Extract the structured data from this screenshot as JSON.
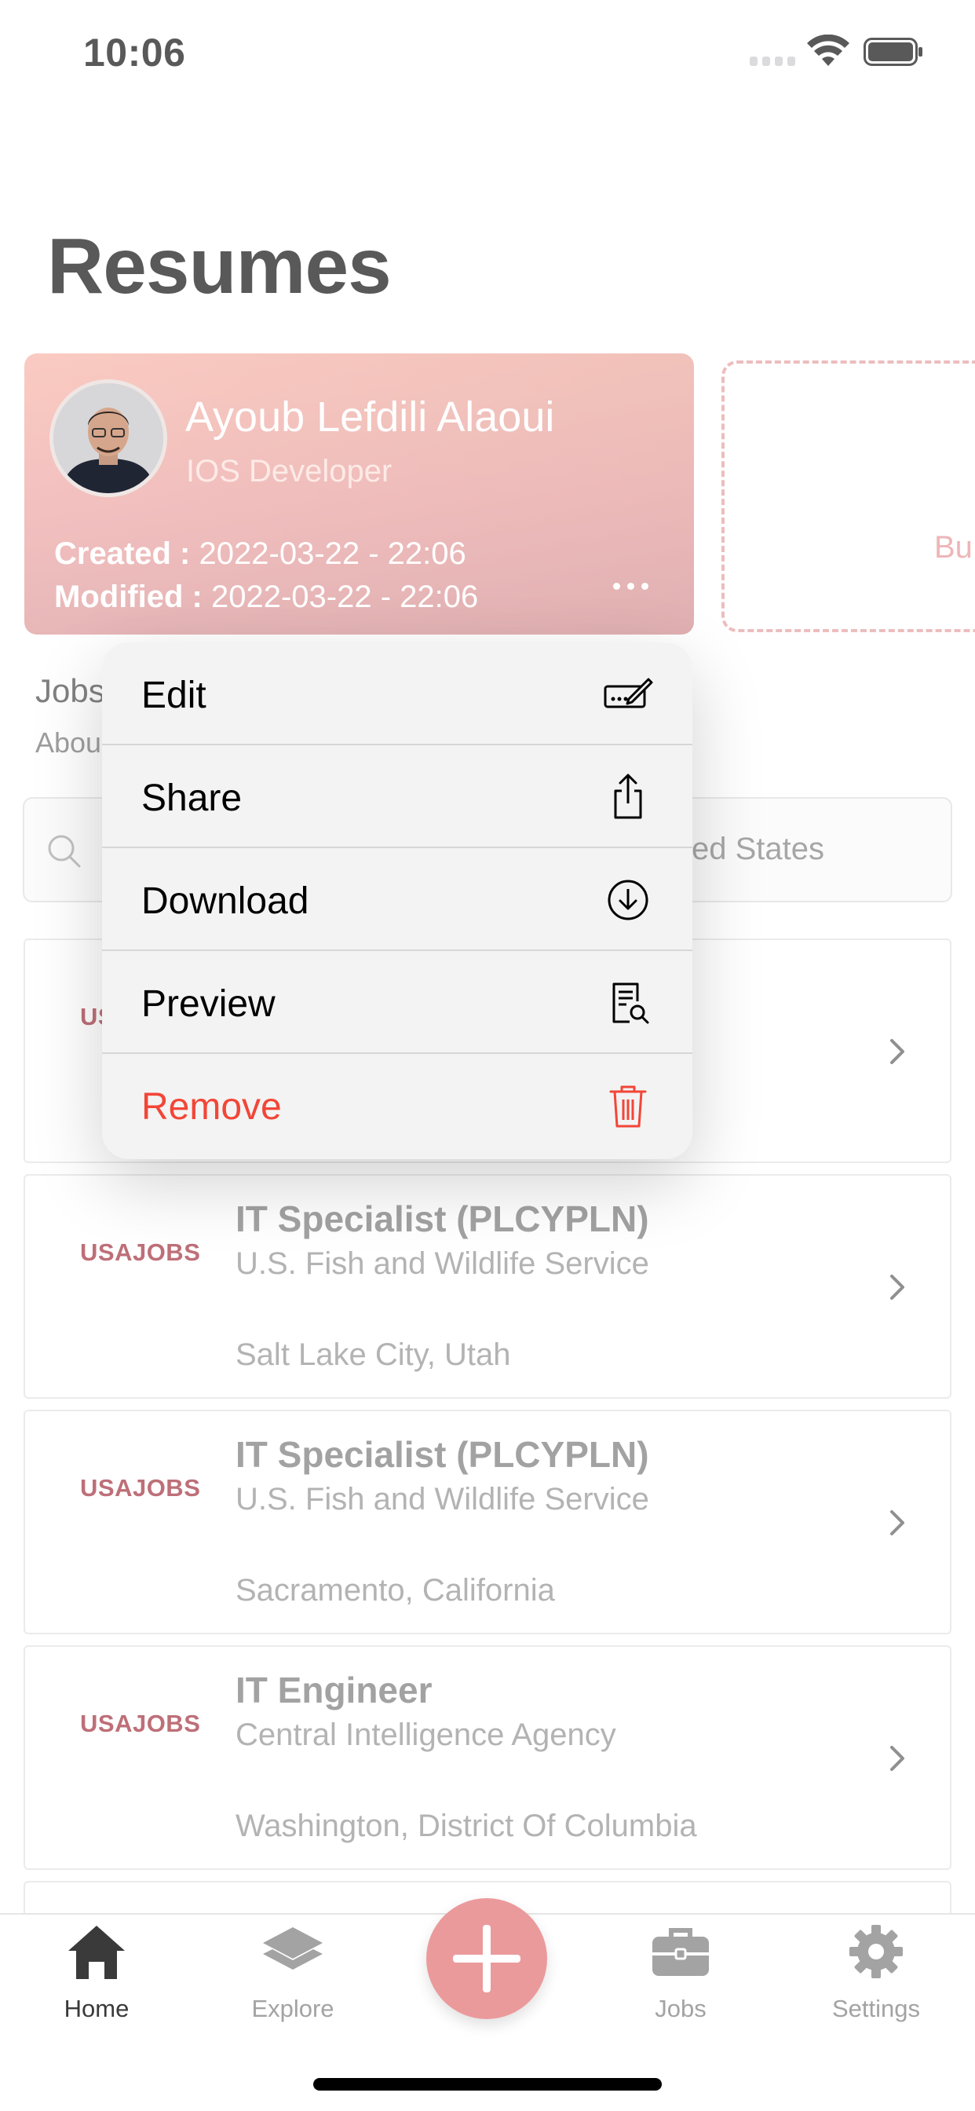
{
  "status_bar": {
    "time": "10:06"
  },
  "page": {
    "title": "Resumes"
  },
  "resume_card": {
    "name": "Ayoub Lefdili Alaoui",
    "role": "IOS Developer",
    "created_label": "Created :",
    "created_value": "2022-03-22 - 22:06",
    "modified_label": "Modified :",
    "modified_value": "2022-03-22 - 22:06"
  },
  "add_resume": {
    "label": "Bu"
  },
  "jobs_section": {
    "heading": "Jobs",
    "sub": "Abou"
  },
  "search": {
    "location": "ed States"
  },
  "context_menu": {
    "items": [
      {
        "label": "Edit",
        "icon": "signature-icon"
      },
      {
        "label": "Share",
        "icon": "share-icon"
      },
      {
        "label": "Download",
        "icon": "download-icon"
      },
      {
        "label": "Preview",
        "icon": "preview-icon"
      },
      {
        "label": "Remove",
        "icon": "trash-icon",
        "destructive": true
      }
    ]
  },
  "jobs": [
    {
      "logo": "US",
      "title": "",
      "agency": "",
      "location": ""
    },
    {
      "logo": "USAJOBS",
      "title": "IT Specialist (PLCYPLN)",
      "agency": "U.S. Fish and Wildlife Service",
      "location": "Salt Lake City, Utah"
    },
    {
      "logo": "USAJOBS",
      "title": "IT Specialist (PLCYPLN)",
      "agency": "U.S. Fish and Wildlife Service",
      "location": "Sacramento, California"
    },
    {
      "logo": "USAJOBS",
      "title": "IT Engineer",
      "agency": "Central Intelligence Agency",
      "location": "Washington, District Of Columbia"
    }
  ],
  "tab_bar": {
    "tabs": [
      {
        "label": "Home",
        "icon": "home-icon",
        "active": true
      },
      {
        "label": "Explore",
        "icon": "layers-icon"
      },
      {
        "label": "Jobs",
        "icon": "briefcase-icon"
      },
      {
        "label": "Settings",
        "icon": "gear-icon"
      }
    ],
    "add_button_icon": "plus-icon"
  },
  "colors": {
    "accent": "#eb9a9c",
    "destructive": "#f24637",
    "logo_red": "#9b2231"
  }
}
